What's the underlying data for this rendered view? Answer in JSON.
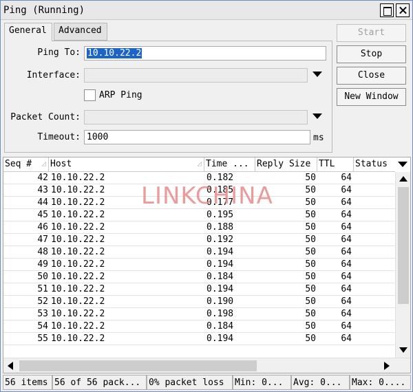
{
  "window": {
    "title": "Ping (Running)"
  },
  "tabs": [
    {
      "label": "General"
    },
    {
      "label": "Advanced"
    }
  ],
  "form": {
    "ping_to_label": "Ping To:",
    "ping_to_value": "10.10.22.2",
    "interface_label": "Interface:",
    "interface_value": "",
    "arp_ping_label": "ARP Ping",
    "arp_ping_checked": false,
    "packet_count_label": "Packet Count:",
    "packet_count_value": "",
    "timeout_label": "Timeout:",
    "timeout_value": "1000",
    "timeout_unit": "ms"
  },
  "buttons": {
    "start": "Start",
    "stop": "Stop",
    "close": "Close",
    "new_window": "New Window"
  },
  "table": {
    "columns": [
      "Seq #",
      "Host",
      "Time ...",
      "Reply Size",
      "TTL",
      "Status"
    ],
    "rows": [
      {
        "seq": "42",
        "host": "10.10.22.2",
        "time": "0.182",
        "size": "50",
        "ttl": "64",
        "status": ""
      },
      {
        "seq": "43",
        "host": "10.10.22.2",
        "time": "0.185",
        "size": "50",
        "ttl": "64",
        "status": ""
      },
      {
        "seq": "44",
        "host": "10.10.22.2",
        "time": "0.177",
        "size": "50",
        "ttl": "64",
        "status": ""
      },
      {
        "seq": "45",
        "host": "10.10.22.2",
        "time": "0.195",
        "size": "50",
        "ttl": "64",
        "status": ""
      },
      {
        "seq": "46",
        "host": "10.10.22.2",
        "time": "0.188",
        "size": "50",
        "ttl": "64",
        "status": ""
      },
      {
        "seq": "47",
        "host": "10.10.22.2",
        "time": "0.192",
        "size": "50",
        "ttl": "64",
        "status": ""
      },
      {
        "seq": "48",
        "host": "10.10.22.2",
        "time": "0.194",
        "size": "50",
        "ttl": "64",
        "status": ""
      },
      {
        "seq": "49",
        "host": "10.10.22.2",
        "time": "0.194",
        "size": "50",
        "ttl": "64",
        "status": ""
      },
      {
        "seq": "50",
        "host": "10.10.22.2",
        "time": "0.184",
        "size": "50",
        "ttl": "64",
        "status": ""
      },
      {
        "seq": "51",
        "host": "10.10.22.2",
        "time": "0.194",
        "size": "50",
        "ttl": "64",
        "status": ""
      },
      {
        "seq": "52",
        "host": "10.10.22.2",
        "time": "0.190",
        "size": "50",
        "ttl": "64",
        "status": ""
      },
      {
        "seq": "53",
        "host": "10.10.22.2",
        "time": "0.198",
        "size": "50",
        "ttl": "64",
        "status": ""
      },
      {
        "seq": "54",
        "host": "10.10.22.2",
        "time": "0.184",
        "size": "50",
        "ttl": "64",
        "status": ""
      },
      {
        "seq": "55",
        "host": "10.10.22.2",
        "time": "0.194",
        "size": "50",
        "ttl": "64",
        "status": ""
      }
    ]
  },
  "watermark": "LINKCHINA",
  "status_bar": {
    "items": "56 items",
    "packets": "56 of 56 pack...",
    "loss": "0% packet loss",
    "min": "Min: 0...",
    "avg": "Avg: 0...",
    "max": "Max: 0...."
  },
  "icons": {
    "maximize": "maximize-icon",
    "close": "close-icon",
    "dropdown": "chevron-down-icon",
    "sort": "sort-icon",
    "scroll_up": "arrow-up-icon",
    "scroll_down": "arrow-down-icon",
    "scroll_left": "arrow-left-icon",
    "scroll_right": "arrow-right-icon"
  },
  "colors": {
    "selection": "#1c64c8",
    "watermark": "#e88a8a",
    "window_border": "#6b8ebd"
  }
}
